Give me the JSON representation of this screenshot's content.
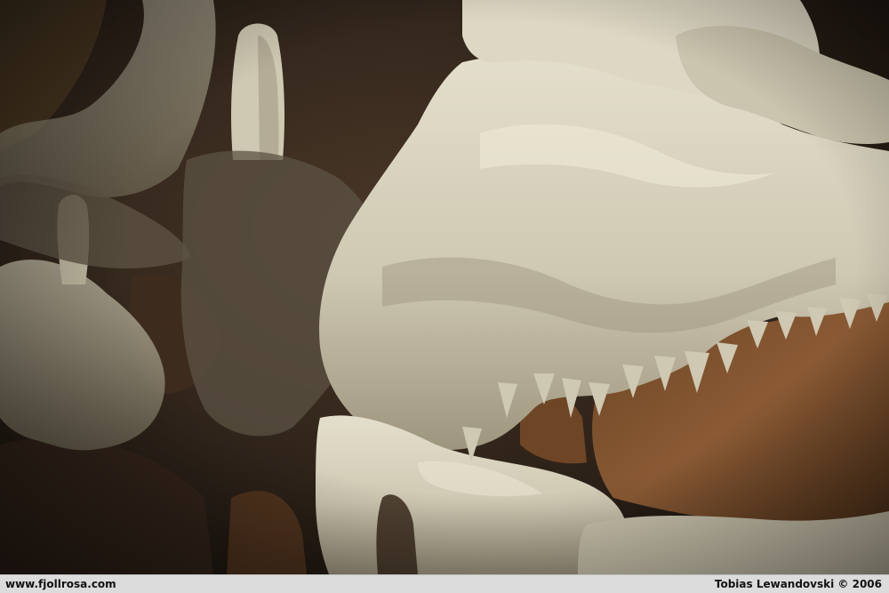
{
  "photo": {
    "subject": "cave-formations",
    "colors": {
      "rock_dark": "#2a1f16",
      "rock_brown": "#6b4a2e",
      "rust": "#8a5a34",
      "flowstone": "#d8d2bf",
      "flowstone_shade": "#a89f88"
    }
  },
  "caption": {
    "website": "www.fjollrosa.com",
    "credit": "Tobias Lewandovski © 2006",
    "bar_color": "#dcdcdc",
    "text_color": "#111111"
  }
}
